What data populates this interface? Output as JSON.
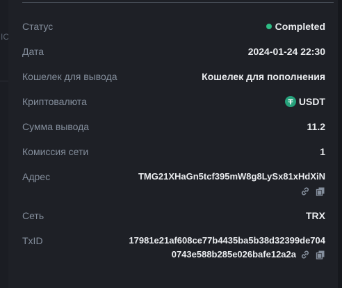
{
  "colors": {
    "background": "#1e2026",
    "label": "#848e9c",
    "value": "#eaecef",
    "status_dot": "#2ebd85",
    "usdt_icon": "#26a17b"
  },
  "sidebar": {
    "ghost_text": "IC"
  },
  "details": {
    "status": {
      "label": "Статус",
      "value": "Completed"
    },
    "date": {
      "label": "Дата",
      "value": "2024-01-24 22:30"
    },
    "wallet": {
      "label": "Кошелек для вывода",
      "value": "Кошелек для пополнения"
    },
    "crypto": {
      "label": "Криптовалюта",
      "value": "USDT",
      "icon": "tether-icon"
    },
    "amount": {
      "label": "Сумма вывода",
      "value": "11.2"
    },
    "fee": {
      "label": "Комиссия сети",
      "value": "1"
    },
    "address": {
      "label": "Адрес",
      "value": "TMG21XHaGn5tcf395mW8g8LySx81xHdXiN",
      "icons": [
        "link-icon",
        "copy-icon"
      ]
    },
    "network": {
      "label": "Сеть",
      "value": "TRX"
    },
    "txid": {
      "label": "TxID",
      "line1": "17981e21af608ce77b4435ba5b38d32399de704",
      "line2": "0743e588b285e026bafe12a2a",
      "icons": [
        "link-icon",
        "copy-icon"
      ]
    }
  }
}
